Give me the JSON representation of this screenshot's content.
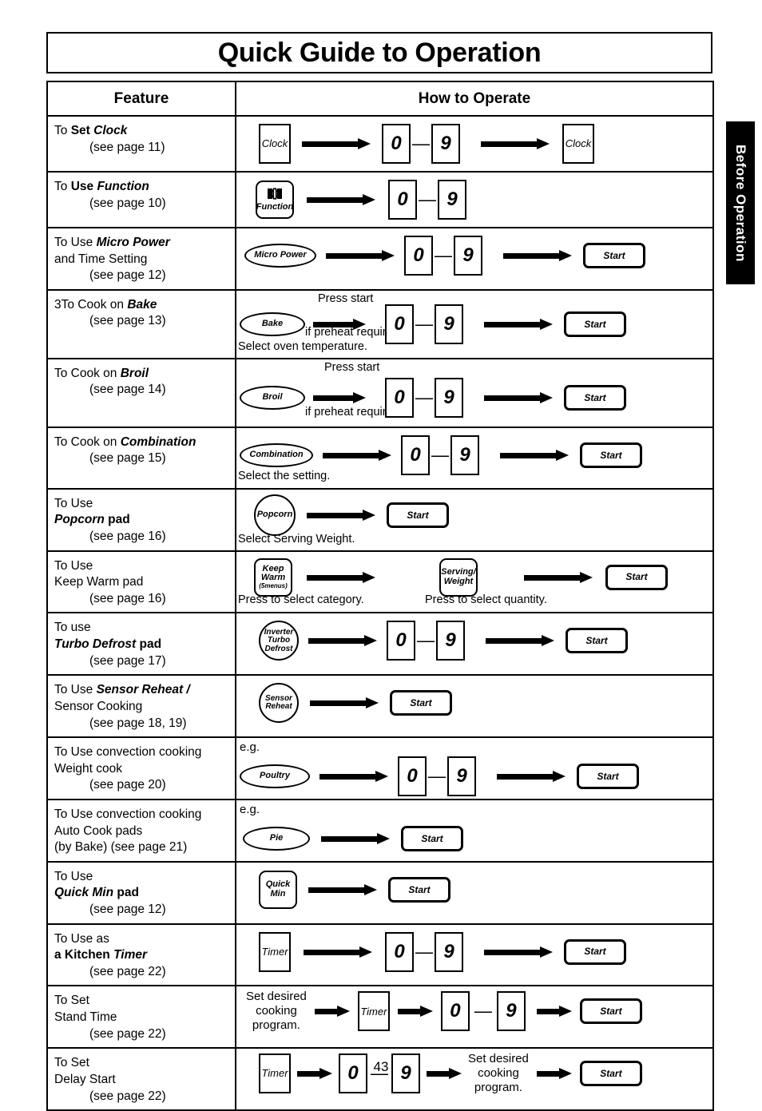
{
  "page": {
    "title": "Quick Guide to Operation",
    "number": "43",
    "side_tab": "Before Operation"
  },
  "table": {
    "headers": {
      "feature": "Feature",
      "how_to_operate": "How to Operate"
    },
    "rows": [
      {
        "feature": {
          "line1_pre": "To ",
          "line1_b": "Set ",
          "line1_bi": "Clock",
          "page_ref": "(see page 11)"
        },
        "steps": [
          {
            "type": "pad-rect",
            "label": "Clock"
          },
          {
            "type": "arrow",
            "size": "lg"
          },
          {
            "type": "num",
            "label": "0"
          },
          {
            "type": "dash",
            "label": "—"
          },
          {
            "type": "num",
            "label": "9"
          },
          {
            "type": "arrow",
            "size": "lg"
          },
          {
            "type": "pad-rect",
            "label": "Clock"
          }
        ]
      },
      {
        "feature": {
          "line1_pre": "To ",
          "line1_b": "Use ",
          "line1_bi": "Function",
          "page_ref": "(see page 10)"
        },
        "steps": [
          {
            "type": "pad-rsq",
            "label": "Function",
            "icon": "microwave-door-icon"
          },
          {
            "type": "arrow",
            "size": "lg"
          },
          {
            "type": "num",
            "label": "0"
          },
          {
            "type": "dash",
            "label": "—"
          },
          {
            "type": "num",
            "label": "9"
          }
        ]
      },
      {
        "feature": {
          "line1_pre": "To Use ",
          "line1_bi": "Micro Power",
          "line2_b": "and Time Setting",
          "page_ref": "(see page 12)"
        },
        "steps": [
          {
            "type": "pad-ellipse",
            "label": "Micro Power",
            "width": "w-micro"
          },
          {
            "type": "arrow",
            "size": "lg"
          },
          {
            "type": "num",
            "label": "0"
          },
          {
            "type": "dash",
            "label": "—"
          },
          {
            "type": "num",
            "label": "9"
          },
          {
            "type": "arrow",
            "size": "lg"
          },
          {
            "type": "pad-start",
            "label": "Start"
          }
        ]
      },
      {
        "feature": {
          "line1_pre": "3To Cook on ",
          "line1_bi": "Bake",
          "page_ref": "(see page 13)"
        },
        "caption_above": "Press start",
        "caption_mid": "if preheat required.",
        "caption_below": "Select oven temperature.",
        "steps": [
          {
            "type": "pad-ellipse",
            "label": "Bake",
            "width": "w-bake"
          },
          {
            "type": "arrow",
            "size": "md"
          },
          {
            "type": "num",
            "label": "0"
          },
          {
            "type": "dash",
            "label": "—"
          },
          {
            "type": "num",
            "label": "9"
          },
          {
            "type": "arrow",
            "size": "lg"
          },
          {
            "type": "pad-start",
            "label": "Start"
          }
        ]
      },
      {
        "feature": {
          "line1_pre": "To Cook on ",
          "line1_bi": "Broil",
          "page_ref": "(see page 14)"
        },
        "caption_above": "Press start",
        "caption_mid": "if preheat required.",
        "steps": [
          {
            "type": "pad-ellipse",
            "label": "Broil",
            "width": "w-broil"
          },
          {
            "type": "arrow",
            "size": "md"
          },
          {
            "type": "num",
            "label": "0"
          },
          {
            "type": "dash",
            "label": "—"
          },
          {
            "type": "num",
            "label": "9"
          },
          {
            "type": "arrow",
            "size": "lg"
          },
          {
            "type": "pad-start",
            "label": "Start"
          }
        ]
      },
      {
        "feature": {
          "line1_pre": "To Cook on ",
          "line1_bi": "Combination",
          "page_ref": "(see page 15)"
        },
        "caption_below": "Select the setting.",
        "steps": [
          {
            "type": "pad-ellipse",
            "label": "Combination",
            "width": "w-comb"
          },
          {
            "type": "arrow",
            "size": "lg"
          },
          {
            "type": "num",
            "label": "0"
          },
          {
            "type": "dash",
            "label": "—"
          },
          {
            "type": "num",
            "label": "9"
          },
          {
            "type": "arrow",
            "size": "lg"
          },
          {
            "type": "pad-start",
            "label": "Start"
          }
        ]
      },
      {
        "feature": {
          "line1_pre": "To Use",
          "line2_bi": "Popcorn",
          "line2_b": " pad",
          "page_ref": "(see page 16)"
        },
        "caption_below": "Select Serving Weight.",
        "steps": [
          {
            "type": "pad-circle",
            "label": "Popcorn"
          },
          {
            "type": "arrow",
            "size": "lg"
          },
          {
            "type": "pad-start",
            "label": "Start"
          }
        ]
      },
      {
        "feature": {
          "line1_pre": "To Use",
          "line2_b": "Keep Warm pad",
          "page_ref": "(see page 16)"
        },
        "caption_below_1": "Press to select category.",
        "caption_below_2": "Press to select quantity.",
        "steps": [
          {
            "type": "pad-rsq",
            "label": "Keep Warm",
            "sub": "(5menus)"
          },
          {
            "type": "arrow",
            "size": "lg"
          },
          {
            "type": "pad-rsq",
            "label": "Serving/ Weight"
          },
          {
            "type": "arrow",
            "size": "lg"
          },
          {
            "type": "pad-start",
            "label": "Start"
          }
        ]
      },
      {
        "feature": {
          "line1_pre": "To use",
          "line2_bi": "Turbo Defrost",
          "line2_b": " pad",
          "page_ref": "(see page 17)"
        },
        "steps": [
          {
            "type": "pad-circle",
            "label": "Inverter Turbo Defrost"
          },
          {
            "type": "arrow",
            "size": "lg"
          },
          {
            "type": "num",
            "label": "0"
          },
          {
            "type": "dash",
            "label": "—"
          },
          {
            "type": "num",
            "label": "9"
          },
          {
            "type": "arrow",
            "size": "lg"
          },
          {
            "type": "pad-start",
            "label": "Start"
          }
        ]
      },
      {
        "feature": {
          "line1_pre": "To Use ",
          "line1_bi": "Sensor Reheat /",
          "line2_b": "Sensor Cooking",
          "page_ref": "(see page 18, 19)"
        },
        "steps": [
          {
            "type": "pad-circle",
            "label": "Sensor Reheat"
          },
          {
            "type": "arrow",
            "size": "lg"
          },
          {
            "type": "pad-start",
            "label": "Start"
          }
        ]
      },
      {
        "feature": {
          "line1_pre": "To Use convection cooking",
          "line2_b": "Weight cook",
          "page_ref": "(see page 20)"
        },
        "eg": "e.g.",
        "steps": [
          {
            "type": "pad-ellipse",
            "label": "Poultry",
            "width": "w-poultry"
          },
          {
            "type": "arrow",
            "size": "lg"
          },
          {
            "type": "num",
            "label": "0"
          },
          {
            "type": "dash",
            "label": "—"
          },
          {
            "type": "num",
            "label": "9"
          },
          {
            "type": "arrow",
            "size": "lg"
          },
          {
            "type": "pad-start",
            "label": "Start"
          }
        ]
      },
      {
        "feature": {
          "line1_pre": "To Use convection cooking",
          "line2_b": "Auto Cook pads",
          "page_ref": "(by Bake) (see page 21)"
        },
        "eg": "e.g.",
        "steps": [
          {
            "type": "pad-ellipse",
            "label": "Pie",
            "width": "w-pie"
          },
          {
            "type": "arrow",
            "size": "lg"
          },
          {
            "type": "pad-start",
            "label": "Start"
          }
        ]
      },
      {
        "feature": {
          "line1_pre": "To Use",
          "line2_bi": "Quick Min",
          "line2_b": " pad",
          "page_ref": "(see page 12)"
        },
        "steps": [
          {
            "type": "pad-rsq",
            "label": "Quick Min"
          },
          {
            "type": "arrow",
            "size": "lg"
          },
          {
            "type": "pad-start",
            "label": "Start"
          }
        ]
      },
      {
        "feature": {
          "line1_pre": "To Use as",
          "line2_b": "a Kitchen ",
          "line2_bi": "Timer",
          "page_ref": "(see page 22)"
        },
        "steps": [
          {
            "type": "pad-rect",
            "label": "Timer"
          },
          {
            "type": "arrow",
            "size": "lg"
          },
          {
            "type": "num",
            "label": "0"
          },
          {
            "type": "dash",
            "label": "—"
          },
          {
            "type": "num",
            "label": "9"
          },
          {
            "type": "arrow",
            "size": "lg"
          },
          {
            "type": "pad-start",
            "label": "Start"
          }
        ]
      },
      {
        "feature": {
          "line1_pre": "To Set",
          "line2_b": "Stand Time",
          "page_ref": "(see page 22)"
        },
        "text_block": "Set desired cooking program.",
        "steps": [
          {
            "type": "text",
            "label": "Set desired cooking program."
          },
          {
            "type": "arrow",
            "size": "sm"
          },
          {
            "type": "pad-rect",
            "label": "Timer"
          },
          {
            "type": "arrow",
            "size": "sm"
          },
          {
            "type": "num",
            "label": "0"
          },
          {
            "type": "dash",
            "label": "—"
          },
          {
            "type": "num",
            "label": "9"
          },
          {
            "type": "arrow",
            "size": "sm"
          },
          {
            "type": "pad-start",
            "label": "Start"
          }
        ]
      },
      {
        "feature": {
          "line1_pre": "To Set",
          "line2_b": "Delay Start",
          "page_ref": "(see page 22)"
        },
        "text_block": "Set desired cooking program.",
        "steps": [
          {
            "type": "pad-rect",
            "label": "Timer"
          },
          {
            "type": "arrow",
            "size": "sm"
          },
          {
            "type": "num",
            "label": "0"
          },
          {
            "type": "dash",
            "label": "—"
          },
          {
            "type": "num",
            "label": "9"
          },
          {
            "type": "arrow",
            "size": "sm"
          },
          {
            "type": "text",
            "label": "Set desired cooking program."
          },
          {
            "type": "arrow",
            "size": "sm"
          },
          {
            "type": "pad-start",
            "label": "Start"
          }
        ]
      }
    ]
  },
  "labels": {
    "clock": "Clock",
    "function": "Function",
    "micro_power": "Micro Power",
    "bake": "Bake",
    "broil": "Broil",
    "combination": "Combination",
    "popcorn": "Popcorn",
    "keep_warm_l1": "Keep",
    "keep_warm_l2": "Warm",
    "keep_warm_sub": "(5menus)",
    "serving_l1": "Serving/",
    "serving_l2": "Weight",
    "defrost_l1": "Inverter",
    "defrost_l2": "Turbo",
    "defrost_l3": "Defrost",
    "sensor_l1": "Sensor",
    "sensor_l2": "Reheat",
    "poultry": "Poultry",
    "pie": "Pie",
    "quick_l1": "Quick",
    "quick_l2": "Min",
    "timer": "Timer",
    "start": "Start",
    "zero": "0",
    "nine": "9",
    "dash": "—",
    "press_start": "Press start",
    "if_preheat": "if preheat required.",
    "select_oven_temp": "Select oven temperature.",
    "select_setting": "Select the setting.",
    "select_serving_weight": "Select Serving Weight.",
    "press_category": "Press to select category.",
    "press_quantity": "Press to select quantity.",
    "eg": "e.g.",
    "set_desired_1": "Set desired",
    "set_desired_2": "cooking",
    "set_desired_3": "program."
  }
}
